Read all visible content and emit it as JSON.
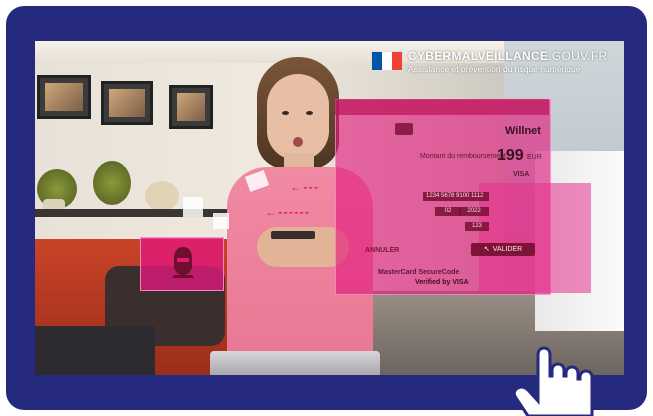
{
  "brand": {
    "name_bold": "CYBERMALVEILLANCE",
    "name_light": ".GOUV.FR",
    "tagline": "Assistance et prévention du risque numérique"
  },
  "overlay": {
    "merchant": "Willnet",
    "refund_label": "Montant du remboursement",
    "amount": "199",
    "currency": "EUR",
    "card_number": "1234 5678 9100 1112",
    "month": "02",
    "year": "2022",
    "cvv": "123",
    "validate_button": "VALIDER",
    "cancel_button": "ANNULER",
    "card_brand": "VISA",
    "verified_label": "Verified by VISA",
    "mastercard_label": "MasterCard SecureCode"
  },
  "colors": {
    "frame": "#262a7e",
    "overlay_pink": "#e2187d",
    "button": "#7d1438"
  },
  "icons": [
    "card-icon",
    "thief-icon",
    "arrow-icon",
    "pointing-hand-icon",
    "french-flag-icon"
  ]
}
